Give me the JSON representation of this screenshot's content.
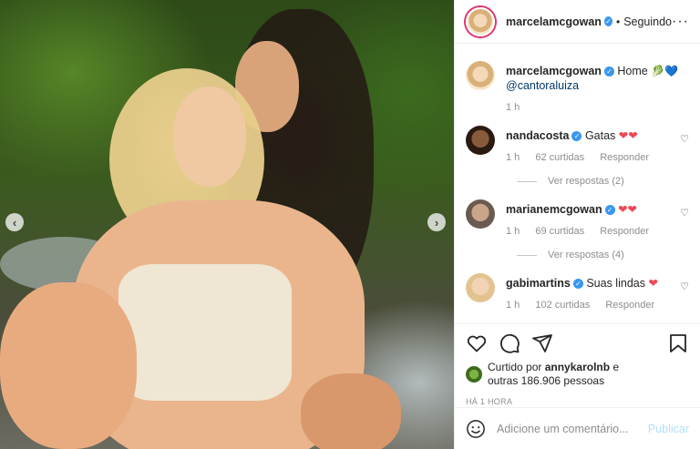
{
  "header": {
    "username": "marcelamcgowan",
    "separator": "•",
    "following": "Seguindo",
    "more": "···"
  },
  "caption": {
    "username": "marcelamcgowan",
    "text": "Home",
    "emoji": "🥬💙",
    "mention": "@cantoraluiza",
    "time": "1 h"
  },
  "comments": [
    {
      "username": "nandacosta",
      "text": "Gatas",
      "hearts": "❤❤",
      "time": "1 h",
      "likes": "62 curtidas",
      "reply": "Responder",
      "view_replies": "Ver respostas (2)"
    },
    {
      "username": "marianemcgowan",
      "text": "",
      "hearts": "❤❤",
      "time": "1 h",
      "likes": "69 curtidas",
      "reply": "Responder",
      "view_replies": "Ver respostas (4)"
    },
    {
      "username": "gabimartins",
      "text": "Suas lindas",
      "hearts": "❤",
      "time": "1 h",
      "likes": "102 curtidas",
      "reply": "Responder"
    }
  ],
  "likes": {
    "prefix": "Curtido por",
    "user": "annykarolnb",
    "middle": "e",
    "others": "outras 186.906 pessoas"
  },
  "timestamp": "HÁ 1 HORA",
  "comment_box": {
    "placeholder": "Adicione um comentário...",
    "publish": "Publicar"
  },
  "carousel": {
    "prev": "‹",
    "next": "›"
  },
  "colors": {
    "verified": "#3897f0",
    "heart": "#ed4956",
    "link": "#00376b",
    "publish": "#b2dffc"
  }
}
